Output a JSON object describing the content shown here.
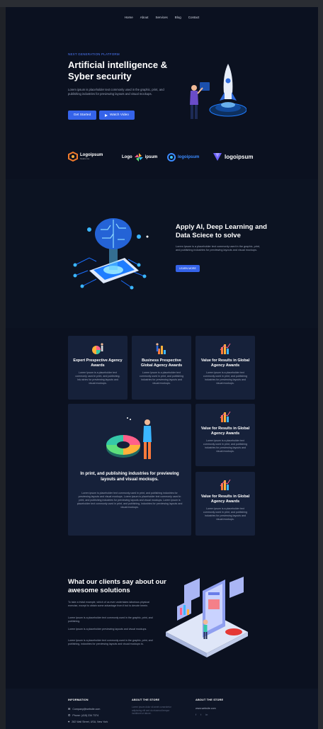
{
  "nav": {
    "items": [
      "Home",
      "About",
      "Services",
      "Blog",
      "Contact"
    ]
  },
  "hero": {
    "kicker": "NEXT GENERATION PLATFORM",
    "title": "Artificial intelligence & Syber security",
    "text": "Lorem ipsum is placeholder text commonly used in the graphic, print, and publishing industries for previewing layouts and visual mockups.",
    "primary_button": "Get Started",
    "secondary_button": "Watch Video"
  },
  "logos": [
    {
      "name": "Logoipsum",
      "sub": "Studio Co.",
      "icon": "hexagon-logo-icon"
    },
    {
      "name": "Logo",
      "name2": "ipsum",
      "icon": "pinwheel-logo-icon"
    },
    {
      "name": "logoipsum",
      "icon": "swirl-logo-icon"
    },
    {
      "name": "logoipsum",
      "icon": "diamond-logo-icon"
    }
  ],
  "section2": {
    "title": "Apply AI, Deep Learning and Data Sciece to solve",
    "text": "Lorem Ipsum is a placeholder text commonly used in the graphic, print, and publishing industries for previewing layouts and visual mockups.",
    "button": "LEARN MORE"
  },
  "cards": [
    {
      "title": "Expert Prespective Agency Awards",
      "text": "Lorem Ipsum is a placeholder text commonly used in print, and publishing. lnlu stries for previewing layouts and visual mockups."
    },
    {
      "title": "Business Prespective Global Agency Awards",
      "text": "Lorem Ipsum is a placeholder text commonly used in print, and publishing industries for previewing layouts and visual mockups."
    },
    {
      "title": "Value for Results in Global Agency Awards",
      "text": "Lorem ipsum is a placeholder text commonly used in print, and publishing industries for previewing layouts and visual mockups."
    },
    {
      "title": "Value for Results in Global Agency Awards",
      "text": "Lorem ipsum is a placeholder text commonly used in print, and publishing industries for previewing layouts and visual mockups."
    },
    {
      "title": "Value for Results in Global Agency Awards",
      "text": "Lorem ipsum is a placeholder text commonly used in print, and publishing industries for previewing layouts and visual mockups."
    }
  ],
  "big_card": {
    "title": "In print, and publishing industries for previewing layouts and visual mockups.",
    "text": "Lorem ipsum is placeholder text commonly used in print, and publishing industries for previewing layouts and visual mockups. Lorem ipsum is placeholder text commonly used in print, and publishing industries for previewing layouts and visual mockups. Lorem ipsum is placeholder text commonly used in print, and publishing, industries for previewing layouts and visual mockups."
  },
  "testimonials": {
    "title": "What our clients say about our awesome solutions",
    "p1": "To take a trivial example, which of us ever undertakes laborious physical exercise, except to obtain some advantage from it but to devote herein.",
    "p2": "Lorem Ipsum is a placeholder text commonly used in the graphic, print, and publishing.",
    "p3": "Lorem Ipsum is a placeholder previewing layouts and visual mockups.",
    "p4": "Lorem Ipsum is a placeholder text commonly used in the graphic, print, and publishing, industries for previewing layouts and visual mockups to."
  },
  "footer": {
    "col1_heading": "INFORMATION",
    "email": "Company@website.com",
    "phone": "Phone: (415) 234 7374",
    "address": "282 Wall Street, USA, New York",
    "col2_heading": "ABOUT THE STORE",
    "col2_text": "Lorem ipsum dolor sit amet consectetur adipiscing elit sed do eiusmod tempor incididunt ut labore.",
    "col3_heading": "ABOUT THE STORE",
    "site": "www.website.com",
    "social": [
      "f",
      "t",
      "in"
    ]
  },
  "colors": {
    "accent": "#3563e9",
    "background": "#0b1120",
    "card": "#16213a"
  }
}
